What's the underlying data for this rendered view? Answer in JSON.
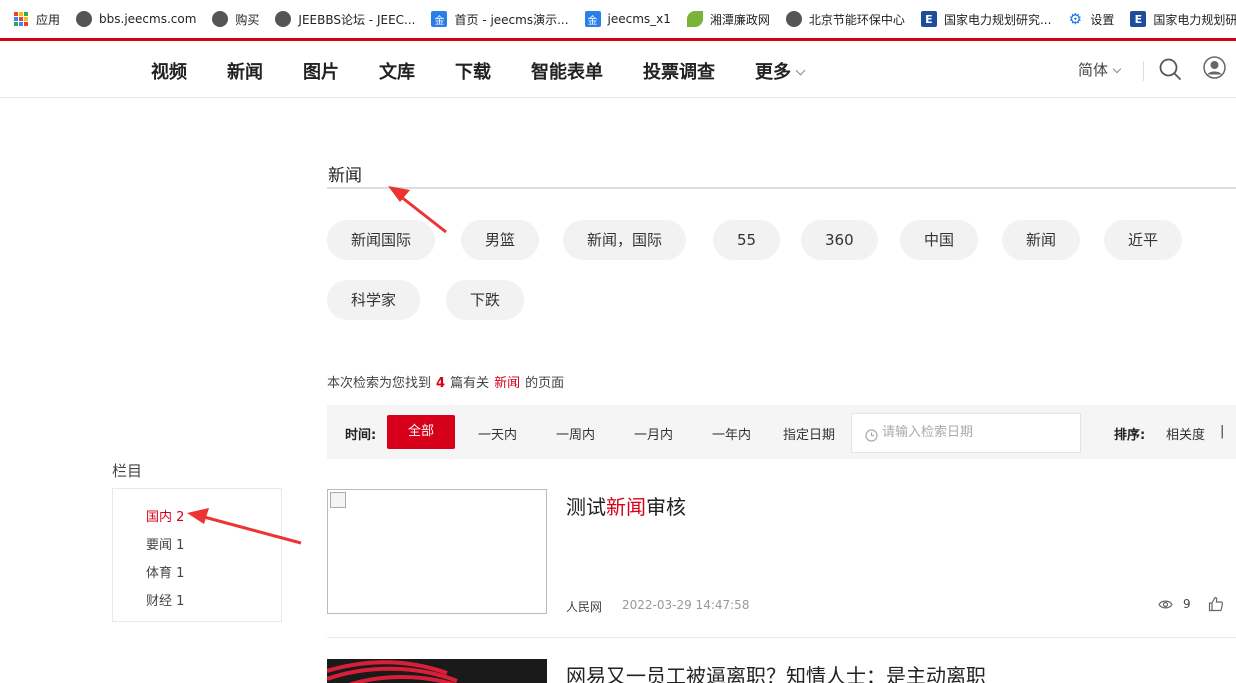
{
  "bookmarks": [
    {
      "label": "应用",
      "icon": "apps-icon"
    },
    {
      "label": "bbs.jeecms.com",
      "icon": "globe-icon"
    },
    {
      "label": "购买",
      "icon": "globe-icon"
    },
    {
      "label": "JEEBBS论坛 - JEEC...",
      "icon": "globe-icon"
    },
    {
      "label": "首页 - jeecms演示...",
      "icon": "jin-icon"
    },
    {
      "label": "jeecms_x1",
      "icon": "jin-icon"
    },
    {
      "label": "湘潭廉政网",
      "icon": "leaf-icon"
    },
    {
      "label": "北京节能环保中心",
      "icon": "globe-icon"
    },
    {
      "label": "国家电力规划研究...",
      "icon": "e-icon"
    },
    {
      "label": "设置",
      "icon": "gear-icon"
    },
    {
      "label": "国家电力规划研究",
      "icon": "e-icon"
    }
  ],
  "nav": {
    "items": [
      "视频",
      "新闻",
      "图片",
      "文库",
      "下载",
      "智能表单",
      "投票调查",
      "更多"
    ],
    "language": "简体"
  },
  "search": {
    "query": "新闻",
    "tags": [
      "新闻国际",
      "男篮",
      "新闻，国际",
      "55",
      "360",
      "中国",
      "新闻",
      "近平",
      "科学家",
      "下跌"
    ]
  },
  "summary": {
    "prefix": "本次检索为您找到",
    "count": "4",
    "middle": "篇有关",
    "keyword": "新闻",
    "suffix": "的页面"
  },
  "filter": {
    "time_label": "时间:",
    "options": [
      "全部",
      "一天内",
      "一周内",
      "一月内",
      "一年内",
      "指定日期"
    ],
    "date_placeholder": "请输入检索日期",
    "sort_label": "排序:",
    "sort_option": "相关度",
    "sort_sep": "|"
  },
  "sidebar": {
    "title": "栏目",
    "items": [
      {
        "label": "国内 2",
        "active": true
      },
      {
        "label": "要闻 1",
        "active": false
      },
      {
        "label": "体育 1",
        "active": false
      },
      {
        "label": "财经 1",
        "active": false
      }
    ]
  },
  "results": [
    {
      "title_pre": "测试",
      "title_hl": "新闻",
      "title_post": "审核",
      "source": "人民网",
      "date": "2022-03-29 14:47:58",
      "views": "9"
    },
    {
      "title": "网易又一员工被逼离职？知情人士：是主动离职"
    }
  ],
  "colors": {
    "accent": "#d7001b",
    "tag_bg": "#f2f2f2",
    "filter_bg": "#f5f5f5",
    "annotation_arrow": "#ee3333"
  }
}
